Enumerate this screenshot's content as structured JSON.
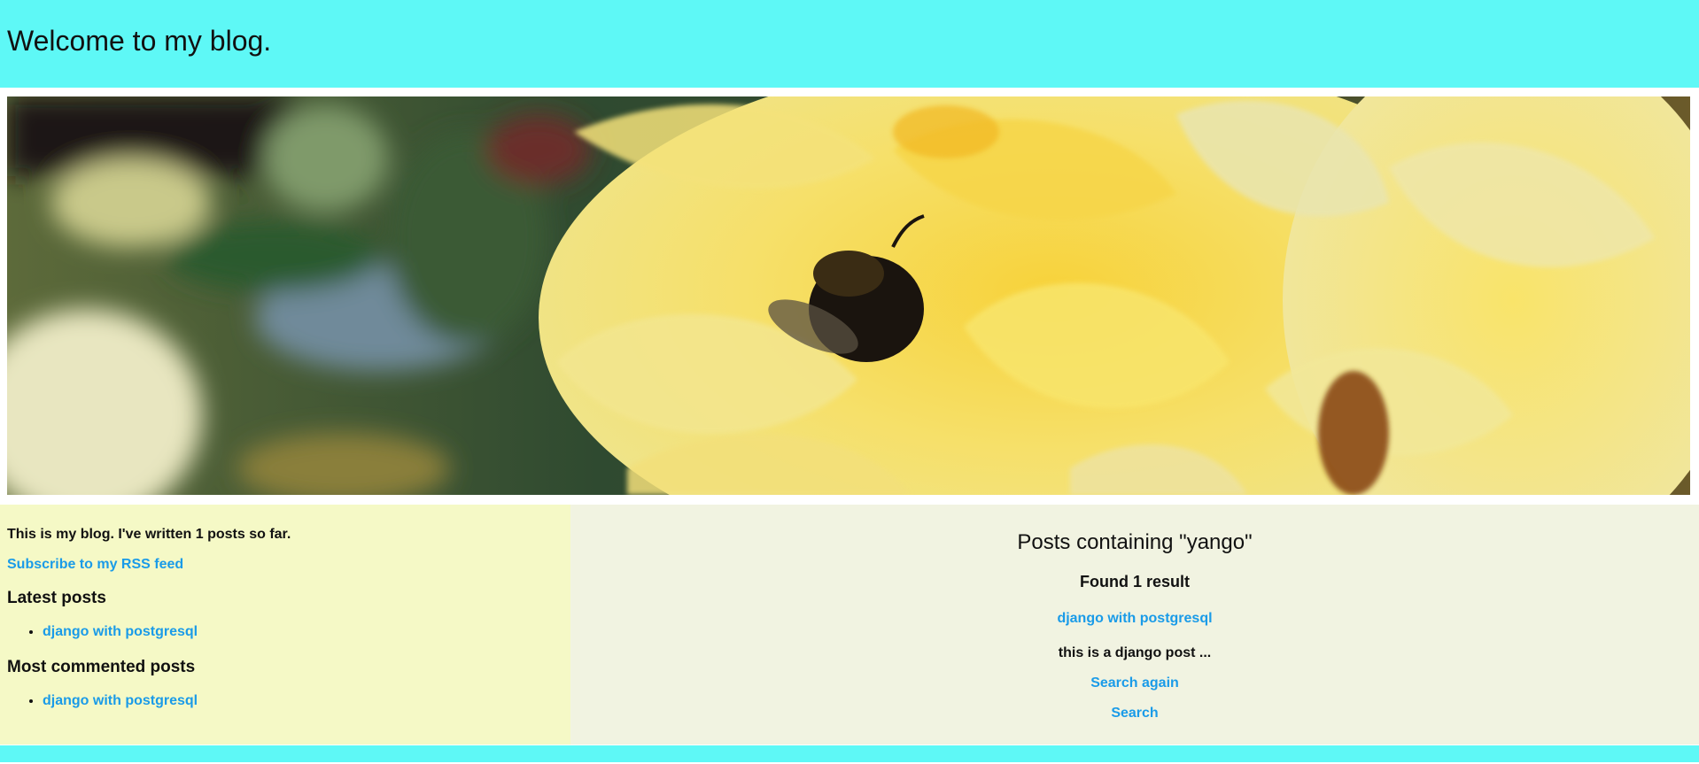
{
  "header": {
    "title": "Welcome to my blog."
  },
  "banner": {
    "description_icon": "photo-bee-on-yellow-rose"
  },
  "sidebar": {
    "intro": "This is my blog. I've written 1 posts so far.",
    "rss_link": "Subscribe to my RSS feed",
    "latest_heading": "Latest posts",
    "latest_posts": [
      "django with postgresql"
    ],
    "commented_heading": "Most commented posts",
    "commented_posts": [
      "django with postgresql"
    ]
  },
  "main": {
    "title": "Posts containing \"yango\"",
    "found": "Found 1 result",
    "results": [
      {
        "title": "django with postgresql",
        "excerpt": "this is a django post ..."
      }
    ],
    "search_again": "Search again",
    "search": "Search"
  },
  "colors": {
    "header_bg": "#5ef8f6",
    "sidebar_bg": "#f5f9c6",
    "main_bg": "#f1f3e1",
    "link": "#1a9be8"
  }
}
